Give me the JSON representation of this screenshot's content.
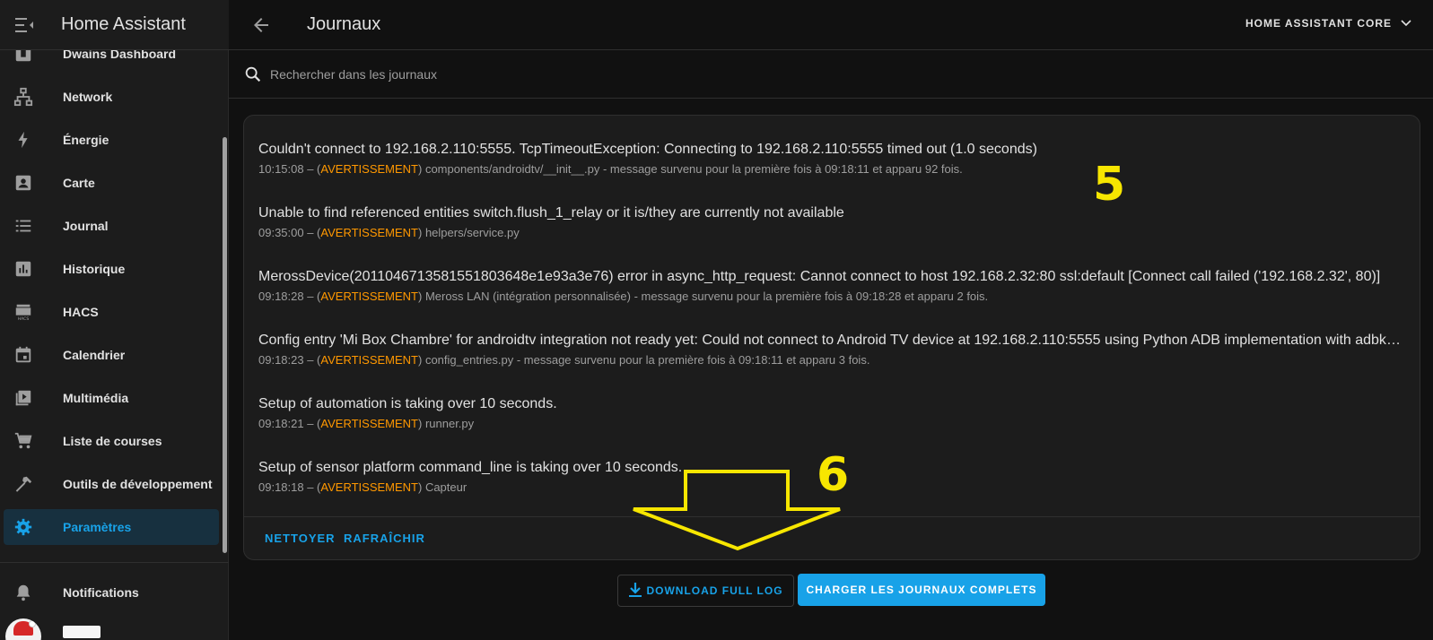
{
  "sidebar": {
    "title": "Home Assistant",
    "items": [
      {
        "label": "Dwains Dashboard",
        "icon": "dashboard-icon"
      },
      {
        "label": "Network",
        "icon": "network-icon"
      },
      {
        "label": "Énergie",
        "icon": "lightning-icon"
      },
      {
        "label": "Carte",
        "icon": "map-account-icon"
      },
      {
        "label": "Journal",
        "icon": "list-icon"
      },
      {
        "label": "Historique",
        "icon": "chart-box-icon"
      },
      {
        "label": "HACS",
        "icon": "hacs-icon"
      },
      {
        "label": "Calendrier",
        "icon": "calendar-icon"
      },
      {
        "label": "Multimédia",
        "icon": "play-box-icon"
      },
      {
        "label": "Liste de courses",
        "icon": "cart-icon"
      },
      {
        "label": "Outils de développement",
        "icon": "hammer-icon"
      },
      {
        "label": "Paramètres",
        "icon": "cog-icon"
      }
    ],
    "notifications_label": "Notifications"
  },
  "topbar": {
    "title": "Journaux",
    "core_select": "HOME ASSISTANT CORE"
  },
  "search": {
    "placeholder": "Rechercher dans les journaux"
  },
  "logs": [
    {
      "message": "Couldn't connect to 192.168.2.110:5555. TcpTimeoutException: Connecting to 192.168.2.110:5555 timed out (1.0 seconds)",
      "time": "10:15:08 – (",
      "level": "AVERTISSEMENT",
      "rest": ") components/androidtv/__init__.py - message survenu pour la première fois à 09:18:11 et apparu 92 fois."
    },
    {
      "message": "Unable to find referenced entities switch.flush_1_relay or it is/they are currently not available",
      "time": "09:35:00 – (",
      "level": "AVERTISSEMENT",
      "rest": ") helpers/service.py"
    },
    {
      "message": "MerossDevice(2011046713581551803648e1e93a3e76) error in async_http_request: Cannot connect to host 192.168.2.32:80 ssl:default [Connect call failed ('192.168.2.32', 80)]",
      "time": "09:18:28 – (",
      "level": "AVERTISSEMENT",
      "rest": ") Meross LAN (intégration personnalisée) - message survenu pour la première fois à 09:18:28 et apparu 2 fois."
    },
    {
      "message": "Config entry 'Mi Box Chambre' for androidtv integration not ready yet: Could not connect to Android TV device at 192.168.2.110:5555 using Python ADB implementation with adbkey=/config/.storage/androidtv_adbkey",
      "time": "09:18:23 – (",
      "level": "AVERTISSEMENT",
      "rest": ") config_entries.py - message survenu pour la première fois à 09:18:11 et apparu 3 fois."
    },
    {
      "message": "Setup of automation is taking over 10 seconds.",
      "time": "09:18:21 – (",
      "level": "AVERTISSEMENT",
      "rest": ") runner.py"
    },
    {
      "message": "Setup of sensor platform command_line is taking over 10 seconds.",
      "time": "09:18:18 – (",
      "level": "AVERTISSEMENT",
      "rest": ") Capteur"
    }
  ],
  "actions": {
    "clear": "NETTOYER",
    "refresh": "RAFRAÎCHIR",
    "download": "DOWNLOAD FULL LOG",
    "load_full": "CHARGER LES JOURNAUX COMPLETS"
  },
  "annotations": {
    "five": "5",
    "six": "6"
  },
  "colors": {
    "accent": "#18a2e8",
    "warning": "#ff9800",
    "annotation": "#f7e600"
  }
}
